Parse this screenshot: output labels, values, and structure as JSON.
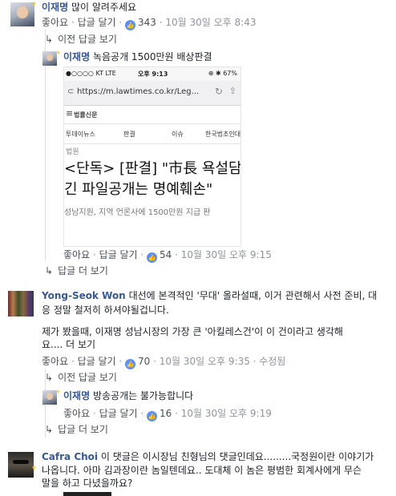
{
  "comment1": {
    "name": "이재명",
    "text": "많이 알려주세요",
    "like": "좋아요",
    "reply": "답글 달기",
    "likes": "343",
    "time": "10월 30일 오후 8:43",
    "prev_replies": "이전 답글 보기"
  },
  "reply1": {
    "name": "이재명",
    "text": "녹음공개 1500만원 배상판결",
    "like": "좋아요",
    "reply": "답글 달기",
    "likes": "54",
    "time": "10월 30일 오후 9:15",
    "more_replies": "답글 더 보기",
    "screenshot": {
      "carrier": "●○○○○ KT  LTE",
      "clock": "오후 9:13",
      "battery": "⊕ ✱ 67%",
      "url": "https://m.lawtimes.co.kr/Leg...",
      "site_name": "법률신문",
      "tabs": [
        "투데이뉴스",
        "판결",
        "이슈",
        "한국법조인대"
      ],
      "section": "법원",
      "headline_1": "<단독> [판결] \"市長 욕설담",
      "headline_2": "긴 파일공개는 명예훼손\"",
      "subtitle": "성남지원, 지역 언론사에 1500만원 지급 판"
    }
  },
  "comment2": {
    "name": "Yong-Seok Won",
    "text_1": "대선에 본격적인 '무대' 올라설때, 이거 관련해서 사전 준비, 대",
    "text_2": "응 정말 철저히 하셔야될겁니다.",
    "text_3": "제가 봤을때, 이재명 성남시장의 가장 큰 '아킬레스건'이 이 건이라고 생각해",
    "text_4": "요.... 더 보기",
    "like": "좋아요",
    "reply": "답글 달기",
    "likes": "70",
    "time": "10월 30일 오후 9:35",
    "edited": "· 수정됨",
    "prev_replies": "이전 답글 보기"
  },
  "reply2": {
    "name": "이재명",
    "text": "방송공개는 불가능합니다",
    "like": "좋아요",
    "reply": "답글 달기",
    "likes": "16",
    "time": "10월 30일 오후 9:19",
    "more_replies": "답글 더 보기"
  },
  "comment3": {
    "name": "Cafra Choi",
    "text_1": "이 댓글은 이시장님 친형님의 댓글인데요.........국정원이란 이야기가",
    "text_2": "나옵니다. 아마 김과장이란 놈일텐데요.. 도대체 이 놈은 평범한 회계사에게 무슨",
    "text_3": "말을 하고 다녔을까요?"
  },
  "colors": {
    "name_link": "#365899",
    "meta": "#90949c",
    "like_bubble": "#5890ff"
  }
}
